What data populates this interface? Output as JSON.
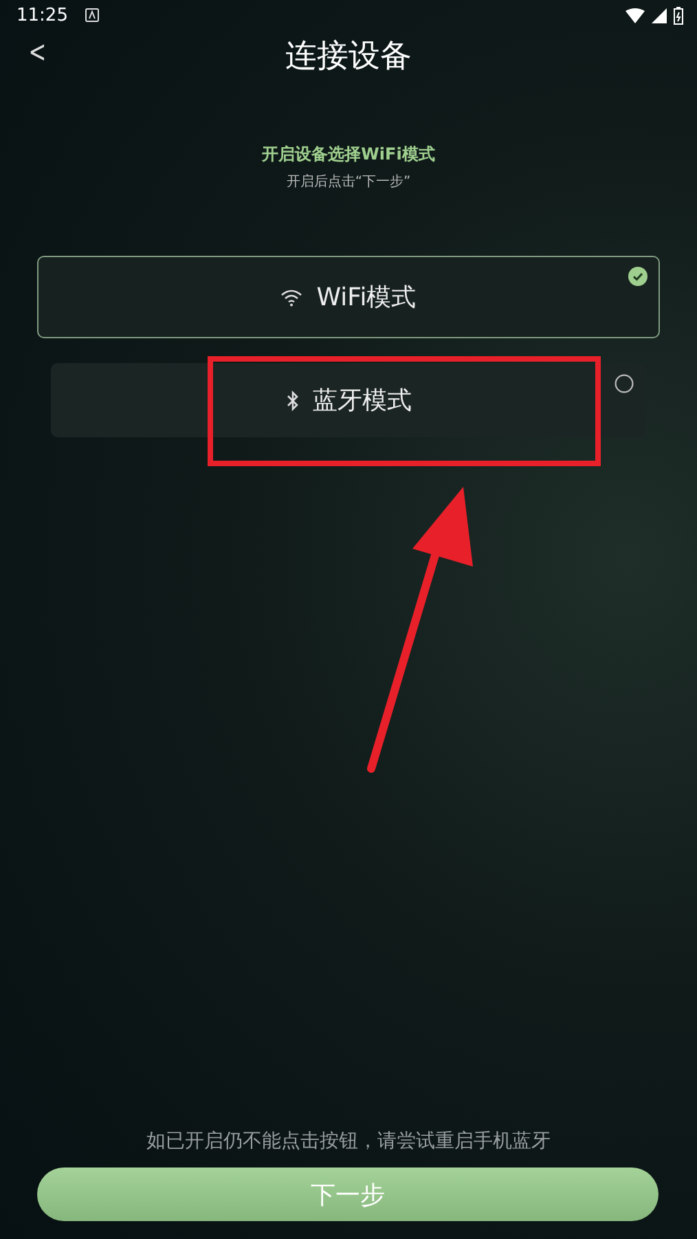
{
  "status_bar": {
    "time": "11:25"
  },
  "header": {
    "back": "<",
    "title": "连接设备"
  },
  "instruction": {
    "heading": "开启设备选择WiFi模式",
    "hint": "开启后点击“下一步”"
  },
  "modes": [
    {
      "kind": "wifi",
      "label": "WiFi模式",
      "selected": true
    },
    {
      "kind": "bluetooth",
      "label": "蓝牙模式",
      "selected": false
    }
  ],
  "footer_hint": "如已开启仍不能点击按钮，请尝试重启手机蓝牙",
  "next_button": "下一步"
}
